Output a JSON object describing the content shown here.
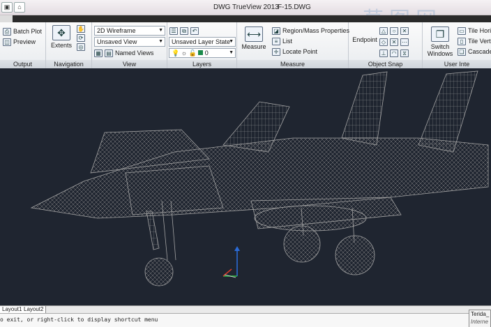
{
  "window": {
    "app_title": "DWG TrueView 2013",
    "file_name": "F-15.DWG"
  },
  "ribbon": {
    "output": {
      "label": "Output",
      "batch_plot": "Batch Plot",
      "preview": "Preview"
    },
    "navigation": {
      "label": "Navigation",
      "extents": "Extents"
    },
    "view": {
      "label": "View",
      "visual_style": "2D Wireframe",
      "saved_view": "Unsaved View",
      "named_views": "Named Views"
    },
    "layers": {
      "label": "Layers",
      "layer_state": "Unsaved Layer State",
      "current_layer": "0"
    },
    "measure": {
      "label": "Measure",
      "measure_button": "Measure",
      "region_mass": "Region/Mass Properties",
      "list": "List",
      "locate_point": "Locate Point"
    },
    "object_snap": {
      "label": "Object Snap",
      "endpoint": "Endpoint"
    },
    "user_interface": {
      "label": "User Inte",
      "switch_windows": "Switch Windows",
      "tile_horizontal": "Tile Horiz",
      "tile_vertical": "Tile Verti",
      "cascade": "Cascade"
    }
  },
  "layout_tabs": [
    "Layout1",
    "Layout2"
  ],
  "command_line": {
    "text": "o exit, or right-click to display shortcut menu"
  },
  "tray": {
    "line1": "Terida_",
    "line2": "Interne"
  },
  "colors": {
    "canvas": "#1f2530",
    "wire": "#9c9c9c",
    "accent_blue": "#2a6bd6"
  }
}
